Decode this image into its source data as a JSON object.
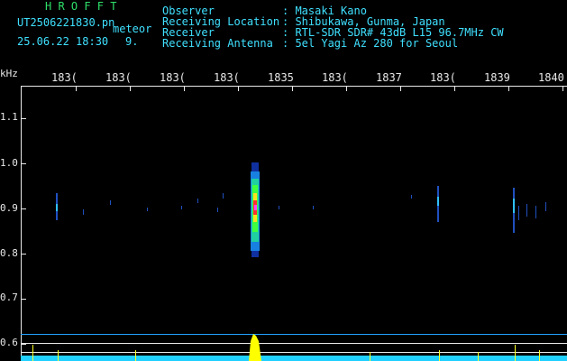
{
  "header": {
    "brand": "H R O F F T",
    "filename": "UT2506221830.pn",
    "mode": "meteor",
    "datetime": "25.06.22 18:30",
    "count": "9.",
    "fields": [
      {
        "label": "Observer",
        "value": ": Masaki Kano"
      },
      {
        "label": "Receiving Location",
        "value": ": Shibukawa, Gunma, Japan"
      },
      {
        "label": "Receiver",
        "value": ": RTL-SDR SDR# 43dB L15 96.7MHz CW"
      },
      {
        "label": "Receiving Antenna",
        "value": ": 5el Yagi Az 280 for Seoul"
      }
    ]
  },
  "axes": {
    "y_unit": "kHz",
    "y_ticks": [
      "1.1",
      "1.0",
      "0.9",
      "0.8",
      "0.7",
      "0.6"
    ],
    "x_ticks": [
      "183(",
      "183(",
      "183(",
      "183(",
      "1835",
      "183(",
      "1837",
      "183(",
      "1839",
      "1840"
    ]
  },
  "colors": {
    "header_text": "#3fe0ff",
    "brand": "#2fe06a",
    "axis": "#e8e8e8",
    "baseline": "#20d0ff",
    "meteor_peak": "#ffff00"
  }
}
